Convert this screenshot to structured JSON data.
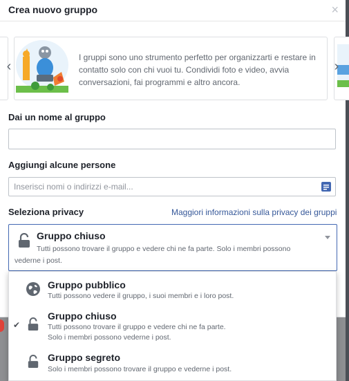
{
  "dialog": {
    "title": "Crea nuovo gruppo",
    "close_icon": "close-icon"
  },
  "carousel": {
    "text": "I gruppi sono uno strumento perfetto per organizzarti e restare in contatto solo con chi vuoi tu. Condividi foto e video, avvia conversazioni, fai programmi e altro ancora.",
    "prev_icon": "chevron-left-icon",
    "next_icon": "chevron-right-icon"
  },
  "form": {
    "name_label": "Dai un nome al gruppo",
    "name_value": "",
    "people_label": "Aggiungi alcune persone",
    "people_placeholder": "Inserisci nomi o indirizzi e-mail...",
    "privacy_label": "Seleziona privacy",
    "privacy_link": "Maggiori informazioni sulla privacy dei gruppi"
  },
  "privacy_select": {
    "selected_title": "Gruppo chiuso",
    "selected_desc": "Tutti possono trovare il gruppo e vedere chi ne fa parte. Solo i membri possono vederne i post.",
    "icon": "lock-icon"
  },
  "privacy_options": [
    {
      "title": "Gruppo pubblico",
      "desc": "Tutti possono vedere il gruppo, i suoi membri e i loro post.",
      "icon": "globe-icon",
      "selected": false
    },
    {
      "title": "Gruppo chiuso",
      "desc_line1": "Tutti possono trovare il gruppo e vedere chi ne fa parte.",
      "desc_line2": "Solo i membri possono vederne i post.",
      "icon": "lock-icon",
      "selected": true
    },
    {
      "title": "Gruppo segreto",
      "desc": "Solo i membri possono trovare il gruppo e vederne i post.",
      "icon": "lock-icon",
      "selected": false
    }
  ],
  "colors": {
    "accent": "#4267b2",
    "link": "#365899",
    "text": "#1d2129",
    "secondary_text": "#616770"
  }
}
